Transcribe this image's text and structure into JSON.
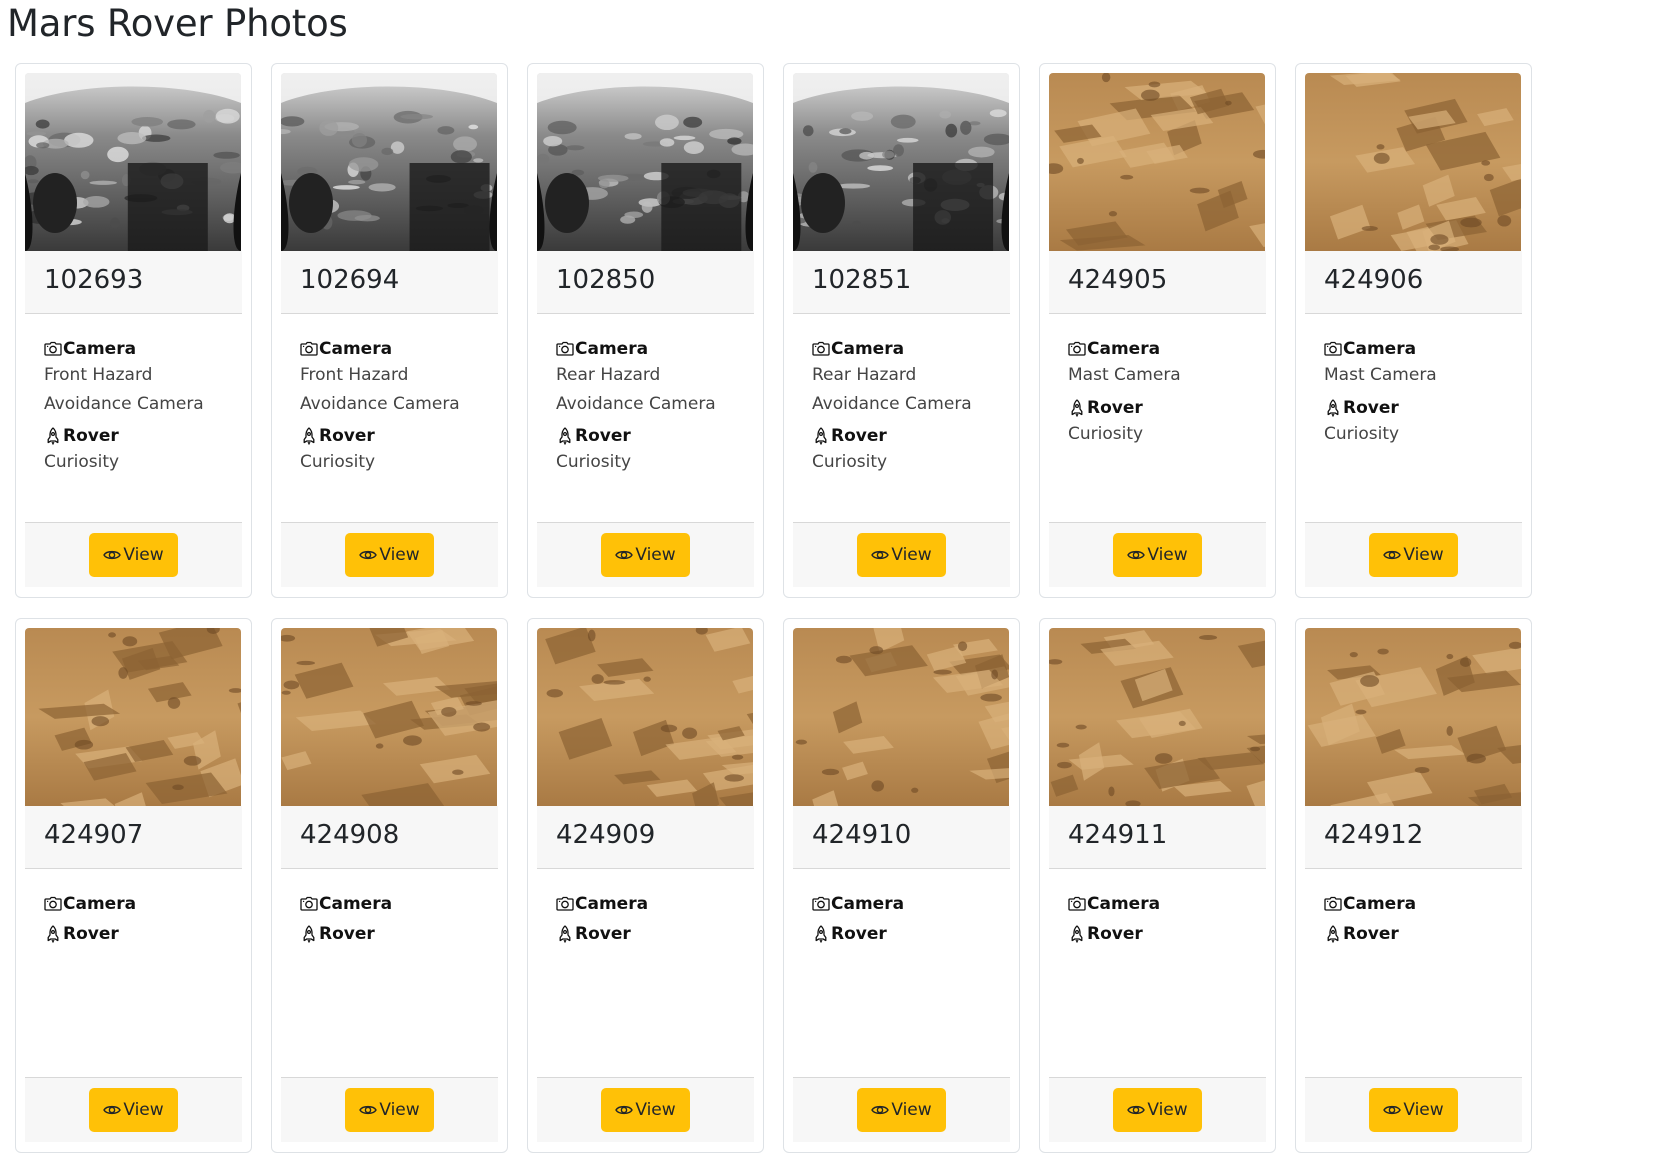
{
  "page": {
    "title": "Mars Rover Photos"
  },
  "labels": {
    "camera": "Camera",
    "rover": "Rover",
    "view": "View"
  },
  "icons": {
    "camera": "camera-icon",
    "rover": "rocket-icon",
    "view": "eye-icon"
  },
  "colors": {
    "view_button": "#ffc107",
    "card_header_bg": "#f7f7f7",
    "card_border": "#dee2e6"
  },
  "photos": [
    {
      "id": "102693",
      "camera": "Front Hazard Avoidance Camera",
      "rover": "Curiosity",
      "palette": "bw"
    },
    {
      "id": "102694",
      "camera": "Front Hazard Avoidance Camera",
      "rover": "Curiosity",
      "palette": "bw"
    },
    {
      "id": "102850",
      "camera": "Rear Hazard Avoidance Camera",
      "rover": "Curiosity",
      "palette": "bw"
    },
    {
      "id": "102851",
      "camera": "Rear Hazard Avoidance Camera",
      "rover": "Curiosity",
      "palette": "bw"
    },
    {
      "id": "424905",
      "camera": "Mast Camera",
      "rover": "Curiosity",
      "palette": "mars"
    },
    {
      "id": "424906",
      "camera": "Mast Camera",
      "rover": "Curiosity",
      "palette": "mars"
    },
    {
      "id": "424907",
      "camera": "",
      "rover": "",
      "palette": "mars"
    },
    {
      "id": "424908",
      "camera": "",
      "rover": "",
      "palette": "mars"
    },
    {
      "id": "424909",
      "camera": "",
      "rover": "",
      "palette": "mars"
    },
    {
      "id": "424910",
      "camera": "",
      "rover": "",
      "palette": "mars"
    },
    {
      "id": "424911",
      "camera": "",
      "rover": "",
      "palette": "mars"
    },
    {
      "id": "424912",
      "camera": "",
      "rover": "",
      "palette": "mars"
    }
  ]
}
